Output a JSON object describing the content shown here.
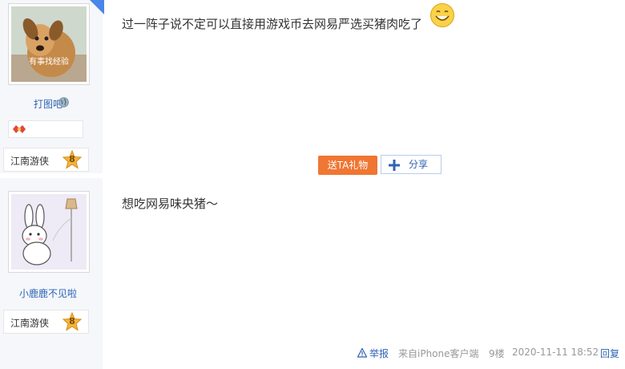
{
  "post1": {
    "username": "打图吧",
    "avatar_caption": "有事找经验",
    "level_name": "江南游侠",
    "level_num": "8",
    "content": "过一阵子说不定可以直接用游戏币去网易严选买猪肉吃了",
    "emoji": "smile-emoji"
  },
  "actions": {
    "gift_label": "送TA礼物",
    "share_label": "分享"
  },
  "post2": {
    "username": "小鹿鹿不见啦",
    "level_name": "江南游侠",
    "level_num": "8",
    "content": "想吃网易味央猪～",
    "footer": {
      "report": "举报",
      "source": "来自iPhone客户端",
      "floor": "9楼",
      "datetime": "2020-11-11 18:52",
      "reply": "回复"
    }
  },
  "colors": {
    "link_blue": "#2d64b3",
    "gift_orange": "#f07633",
    "sidebar_bg": "#f6f7fb"
  }
}
